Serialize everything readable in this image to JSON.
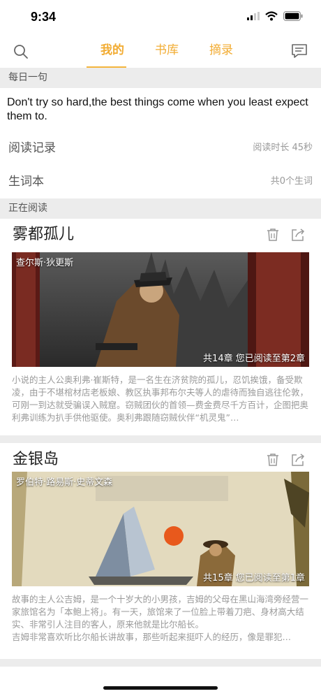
{
  "status_bar": {
    "time": "9:34"
  },
  "nav": {
    "tabs": [
      {
        "label": "我的",
        "active": true
      },
      {
        "label": "书库",
        "active": false
      },
      {
        "label": "摘录",
        "active": false
      }
    ],
    "accent_color": "#f2ac33",
    "icons": {
      "search": "search-icon",
      "messages": "message-icon"
    }
  },
  "daily_quote": {
    "header": "每日一句",
    "text": "Don't try so hard,the best things come when you least expect them to."
  },
  "reading_record": {
    "label": "阅读记录",
    "value": "阅读时长 45秒"
  },
  "vocabulary": {
    "label": "生词本",
    "value": "共0个生词"
  },
  "reading_now": {
    "header": "正在阅读",
    "books": [
      {
        "title": "雾都孤儿",
        "author": "查尔斯·狄更斯",
        "progress": "共14章 您已阅读至第2章",
        "description": "小说的主人公奥利弗·崔斯特，是一名生在济贫院的孤儿，忍饥挨饿，备受欺凌，由于不堪棺材店老板娘、教区执事邦布尔夫等人的虐待而独自逃往伦敦，可刚一到达就受骗误入贼窟。窃贼团伙的首领—费金费尽千方百计，企图把奥利弗训练为扒手供他驱使。奥利弗跟随窃贼伙伴“机灵鬼”…"
      },
      {
        "title": "金银岛",
        "author": "罗伯特·路易斯·史蒂文森",
        "progress": "共15章 您已阅读至第1章",
        "description": "故事的主人公吉姆，是一个十岁大的小男孩，吉姆的父母在黑山海湾旁经营一家旅馆名为「本鲍上将」。有一天，旅馆来了一位脸上带着刀疤、身材高大结实、非常引人注目的客人，原来他就是比尔船长。\n吉姆非常喜欢听比尔船长讲故事，那些听起来挺吓人的经历，像是罪犯…"
      }
    ]
  }
}
